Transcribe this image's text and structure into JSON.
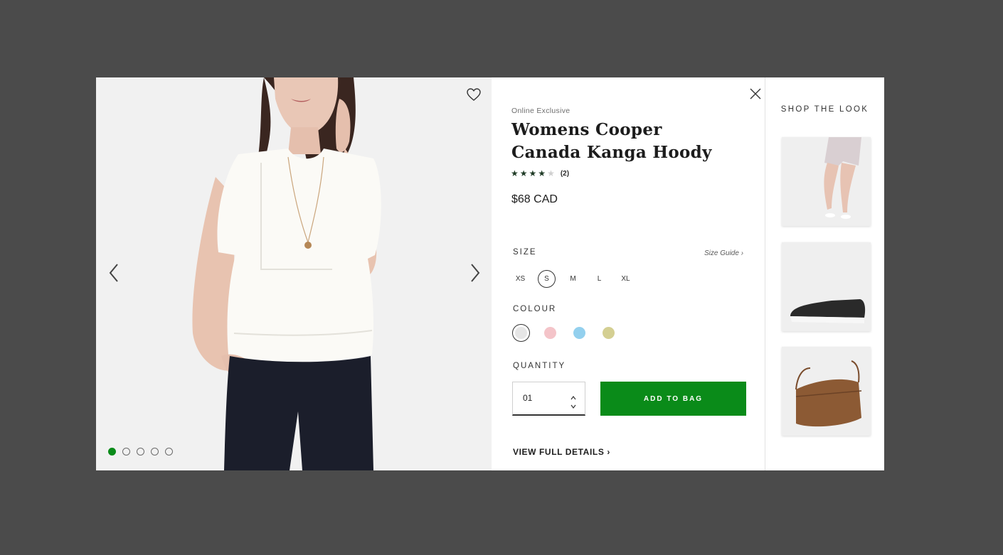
{
  "gallery": {
    "dots": [
      true,
      false,
      false,
      false,
      false
    ],
    "icons": {
      "favourite": "heart-outline-icon",
      "prev": "chevron-left-icon",
      "next": "chevron-right-icon"
    }
  },
  "product": {
    "badge": "Online Exclusive",
    "title_line1": "Womens Cooper",
    "title_line2": "Canada Kanga Hoody",
    "rating": 4,
    "rating_max": 5,
    "review_count": "(2)",
    "price": "$68 CAD"
  },
  "size": {
    "label": "SIZE",
    "guide_link": "Size Guide ›",
    "options": [
      "XS",
      "S",
      "M",
      "L",
      "XL"
    ],
    "selected": "S"
  },
  "colour": {
    "label": "COLOUR",
    "swatches": [
      "#e6e6e6",
      "#f4c4c9",
      "#93d0ee",
      "#d4cf92"
    ],
    "selected_index": 0
  },
  "quantity": {
    "label": "QUANTITY",
    "value": "01"
  },
  "actions": {
    "add_to_bag": "ADD TO BAG",
    "view_full_details": "VIEW FULL DETAILS ›"
  },
  "shop_the_look": {
    "title": "SHOP THE LOOK",
    "items": [
      "floral-shorts-image",
      "black-slip-on-shoe-image",
      "brown-crossbody-bag-image"
    ]
  },
  "colors": {
    "accent": "#0a8b19",
    "overlay": "#4b4b4b",
    "star": "#1f3b26"
  }
}
